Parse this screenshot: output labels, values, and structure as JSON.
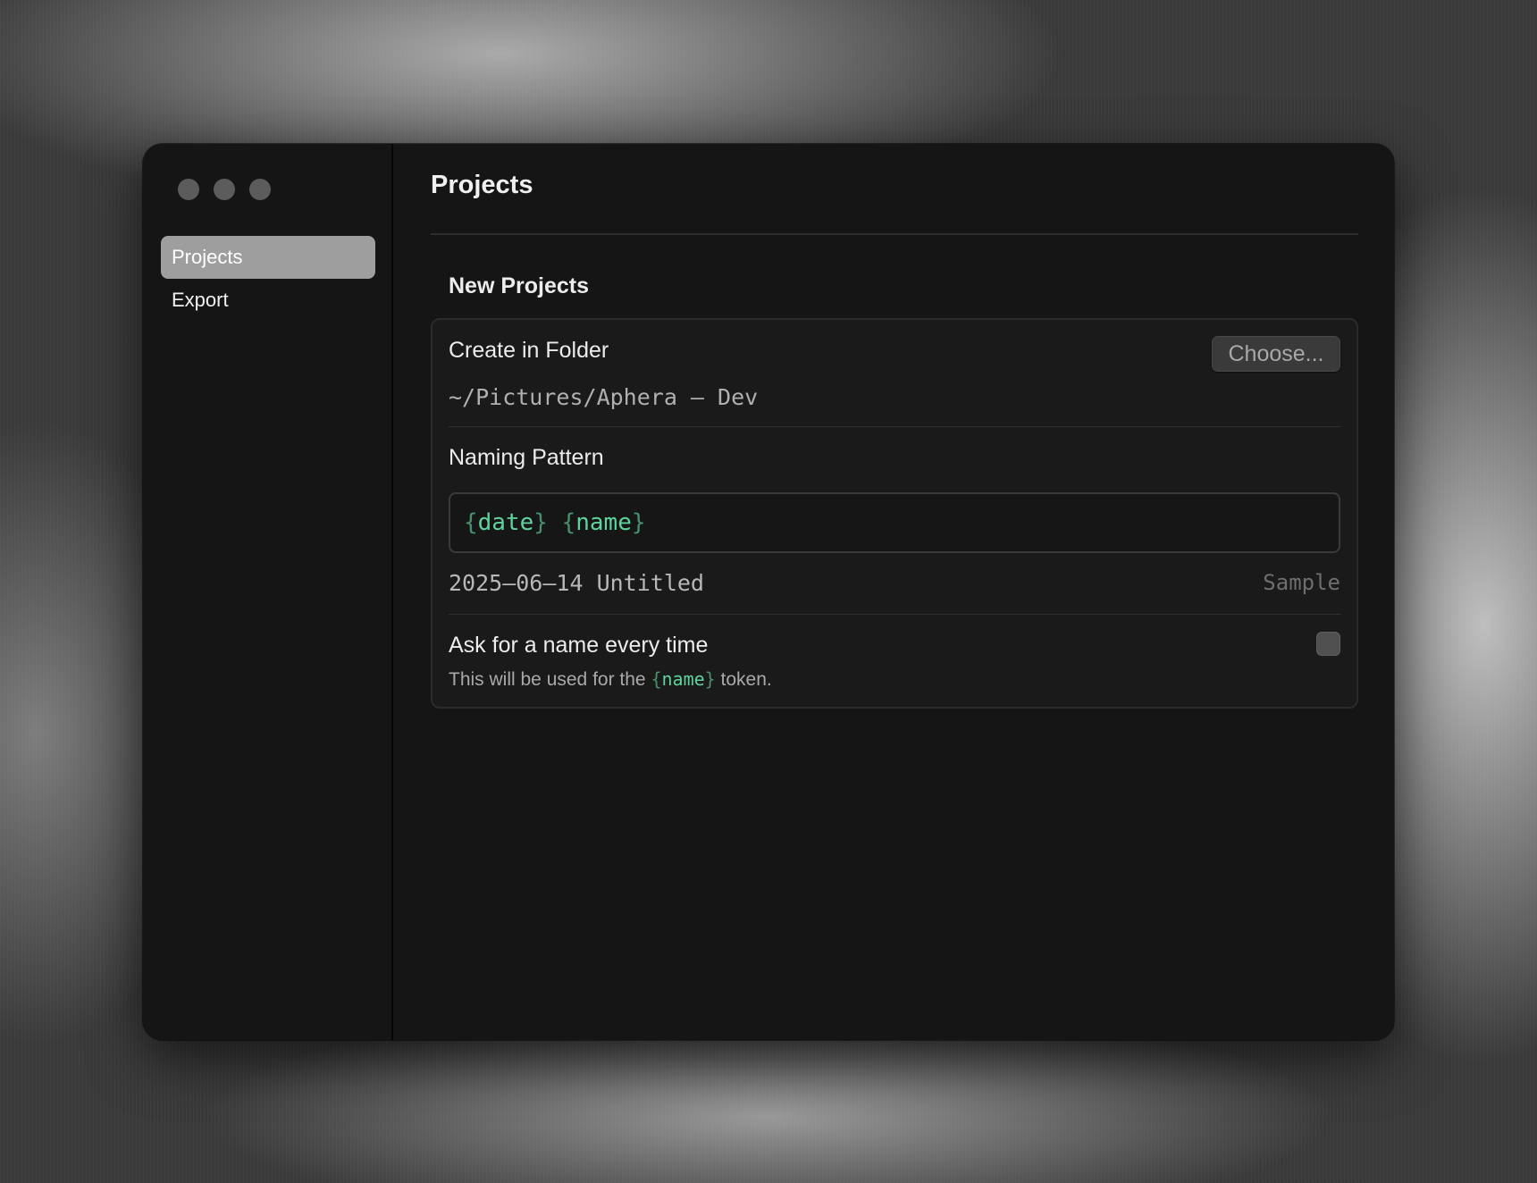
{
  "window": {
    "traffic_lights": [
      "close",
      "minimize",
      "zoom"
    ]
  },
  "sidebar": {
    "items": [
      {
        "label": "Projects",
        "active": true
      },
      {
        "label": "Export",
        "active": false
      }
    ]
  },
  "main": {
    "title": "Projects",
    "section_heading": "New Projects",
    "create_in_folder": {
      "label": "Create in Folder",
      "path": "~/Pictures/Aphera – Dev",
      "choose_button": "Choose..."
    },
    "naming_pattern": {
      "label": "Naming Pattern",
      "tokens": [
        {
          "open": "{",
          "name": "date",
          "close": "}"
        },
        {
          "open": "{",
          "name": "name",
          "close": "}"
        }
      ],
      "sample_value": "2025–06–14 Untitled",
      "sample_label": "Sample"
    },
    "ask_for_name": {
      "label": "Ask for a name every time",
      "checked": false,
      "help_prefix": "This will be used for the ",
      "help_token_open": "{",
      "help_token_name": "name",
      "help_token_close": "}",
      "help_suffix": " token."
    }
  },
  "colors": {
    "window_bg": "#151515",
    "active_nav_bg": "#9e9e9e",
    "token_green": "#5fd39c",
    "brace_green": "#4a8f6d"
  }
}
